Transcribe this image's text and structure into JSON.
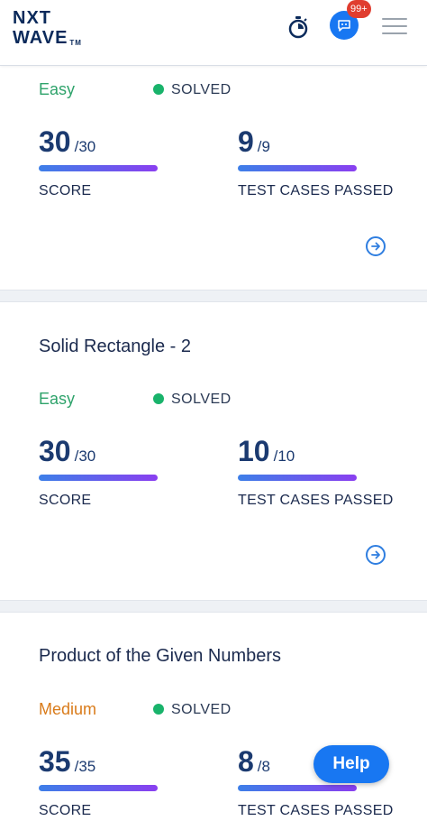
{
  "header": {
    "logo_line1": "NXT",
    "logo_line2": "WAVE",
    "logo_tm": "TM",
    "notification_badge": "99+",
    "icons": [
      "timer-icon",
      "chat-icon",
      "menu-icon"
    ]
  },
  "cards": [
    {
      "title": "",
      "difficulty": "Easy",
      "status": "SOLVED",
      "score_value": "30",
      "score_total": "/30",
      "score_label": "SCORE",
      "score_fraction": 1.0,
      "tests_value": "9",
      "tests_total": "/9",
      "tests_label": "TEST CASES PASSED",
      "tests_fraction": 1.0
    },
    {
      "title": "Solid Rectangle - 2",
      "difficulty": "Easy",
      "status": "SOLVED",
      "score_value": "30",
      "score_total": "/30",
      "score_label": "SCORE",
      "score_fraction": 1.0,
      "tests_value": "10",
      "tests_total": "/10",
      "tests_label": "TEST CASES PASSED",
      "tests_fraction": 1.0
    },
    {
      "title": "Product of the Given Numbers",
      "difficulty": "Medium",
      "status": "SOLVED",
      "score_value": "35",
      "score_total": "/35",
      "score_label": "SCORE",
      "score_fraction": 1.0,
      "tests_value": "8",
      "tests_total": "/8",
      "tests_label": "TEST CASES PASSED",
      "tests_fraction": 1.0
    }
  ],
  "help_label": "Help",
  "colors": {
    "brand_blue": "#1877f2",
    "easy": "#2fa36b",
    "medium": "#d97b1a",
    "solved_dot": "#19b36b",
    "progress_start": "#3d7fe8",
    "progress_end": "#8a3ff0"
  }
}
